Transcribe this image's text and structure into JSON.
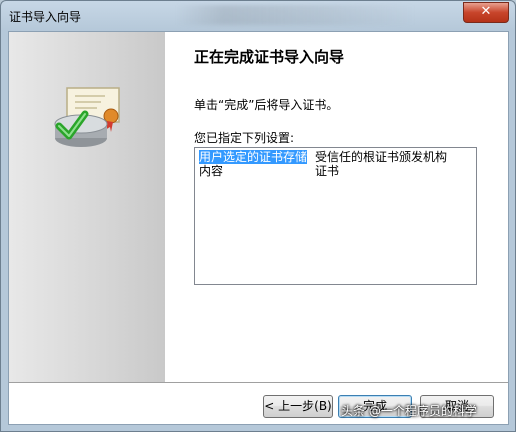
{
  "window": {
    "title": "证书导入向导",
    "close_glyph": "✕"
  },
  "wizard": {
    "heading": "正在完成证书导入向导",
    "description": "单击“完成”后将导入证书。",
    "settings_label": "您已指定下列设置:"
  },
  "settings": [
    {
      "key": "用户选定的证书存储",
      "value": "受信任的根证书颁发机构",
      "selected": true
    },
    {
      "key": "内容",
      "value": "证书"
    }
  ],
  "buttons": {
    "back": "< 上一步(B)",
    "finish": "完成",
    "cancel": "取消"
  },
  "watermark": "头条 @一个程序员的科学"
}
